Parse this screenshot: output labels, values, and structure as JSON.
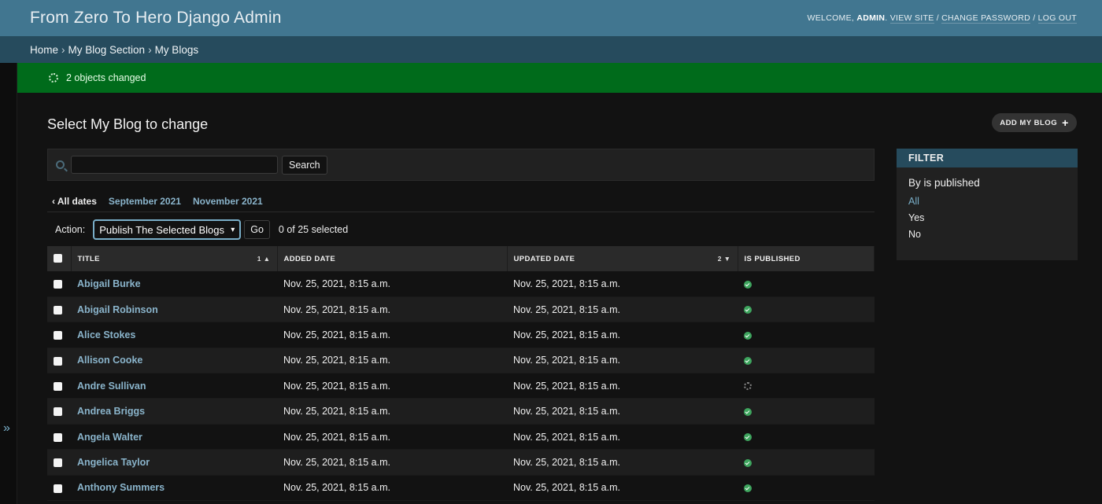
{
  "header": {
    "site_title": "From Zero To Hero Django Admin",
    "welcome": "Welcome,",
    "username": "admin",
    "view_site": "View site",
    "change_password": "Change password",
    "log_out": "Log out",
    "sep": "/"
  },
  "breadcrumbs": [
    "Home",
    "My Blog Section",
    "My Blogs"
  ],
  "breadcrumb_sep": "›",
  "message": "2 objects changed",
  "page": {
    "title": "Select My Blog to change",
    "add_button": "ADD MY BLOG",
    "add_icon": "+"
  },
  "search": {
    "value": "",
    "placeholder": "",
    "button": "Search"
  },
  "date_hierarchy": {
    "back": "‹ All dates",
    "links": [
      "September 2021",
      "November 2021"
    ]
  },
  "actions": {
    "label": "Action:",
    "selected_option": "Publish The Selected Blogs",
    "go": "Go",
    "counter": "0 of 25 selected"
  },
  "table": {
    "columns": {
      "title": "TITLE",
      "title_sort": "1 ▲",
      "added": "ADDED DATE",
      "updated": "UPDATED DATE",
      "updated_sort": "2 ▼",
      "published": "IS PUBLISHED"
    },
    "rows": [
      {
        "title": "Abigail Burke",
        "added": "Nov. 25, 2021, 8:15 a.m.",
        "updated": "Nov. 25, 2021, 8:15 a.m.",
        "published": true
      },
      {
        "title": "Abigail Robinson",
        "added": "Nov. 25, 2021, 8:15 a.m.",
        "updated": "Nov. 25, 2021, 8:15 a.m.",
        "published": true
      },
      {
        "title": "Alice Stokes",
        "added": "Nov. 25, 2021, 8:15 a.m.",
        "updated": "Nov. 25, 2021, 8:15 a.m.",
        "published": true
      },
      {
        "title": "Allison Cooke",
        "added": "Nov. 25, 2021, 8:15 a.m.",
        "updated": "Nov. 25, 2021, 8:15 a.m.",
        "published": true
      },
      {
        "title": "Andre Sullivan",
        "added": "Nov. 25, 2021, 8:15 a.m.",
        "updated": "Nov. 25, 2021, 8:15 a.m.",
        "published": false
      },
      {
        "title": "Andrea Briggs",
        "added": "Nov. 25, 2021, 8:15 a.m.",
        "updated": "Nov. 25, 2021, 8:15 a.m.",
        "published": true
      },
      {
        "title": "Angela Walter",
        "added": "Nov. 25, 2021, 8:15 a.m.",
        "updated": "Nov. 25, 2021, 8:15 a.m.",
        "published": true
      },
      {
        "title": "Angelica Taylor",
        "added": "Nov. 25, 2021, 8:15 a.m.",
        "updated": "Nov. 25, 2021, 8:15 a.m.",
        "published": true
      },
      {
        "title": "Anthony Summers",
        "added": "Nov. 25, 2021, 8:15 a.m.",
        "updated": "Nov. 25, 2021, 8:15 a.m.",
        "published": true
      }
    ]
  },
  "filter": {
    "header": "FILTER",
    "title": "By is published",
    "options": [
      "All",
      "Yes",
      "No"
    ],
    "selected": "All"
  },
  "nav_toggle": "»",
  "colors": {
    "header": "#417690",
    "breadcrumbs": "#264b5d",
    "success": "#006b1b",
    "link": "#8ab4cb",
    "published_yes": "#3ea55e"
  }
}
